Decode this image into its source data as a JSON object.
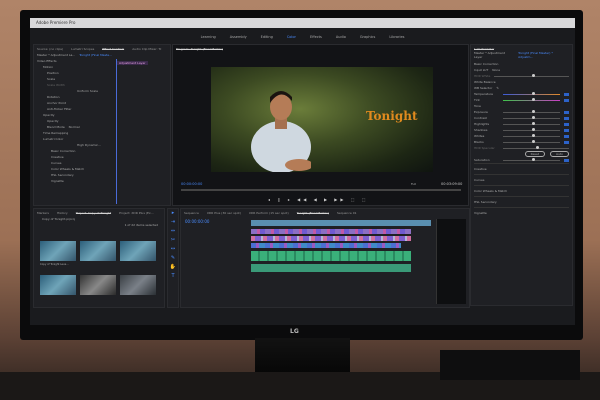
{
  "title_bar": "Adobe Premiere Pro",
  "workspaces": [
    "Learning",
    "Assembly",
    "Editing",
    "Color",
    "Effects",
    "Audio",
    "Graphics",
    "Libraries"
  ],
  "active_workspace": "Color",
  "left_panel": {
    "tabs": [
      "Source: (no clips)",
      "Lumetri Scopes",
      "Effect Controls",
      "Audio Clip Mixer: Tc"
    ],
    "clip": "Master * Adjustment La...",
    "sequence": "Tonight (Final Maste...",
    "tooltip": "Adjustment Layer",
    "section": "Video Effects",
    "items": [
      "Motion",
      "Position",
      "Scale",
      "Scale Width",
      "Uniform Scale",
      "Rotation",
      "Anchor Point",
      "Anti-flicker Filter",
      "Opacity",
      "Opacity",
      "Blend Mode",
      "Time Remapping",
      "Lumetri Color",
      "High Dynamic...",
      "Basic Correction",
      "Creative",
      "Curves",
      "Color Wheels & Match",
      "HSL Secondary",
      "Vignette"
    ],
    "blend_mode": "Normal"
  },
  "program": {
    "tab": "Program: Tonight (Final Master)",
    "overlay_text": "Tonight",
    "timecode_left": "00:00:00:00",
    "fit": "Full",
    "timecode_right": "00:03:09:00"
  },
  "lumetri": {
    "title": "Lumetri Color",
    "clip": "Master * Adjustment Layer",
    "sequence": "Tonight (Final Master) * Adjustm...",
    "basic": "Basic Correction",
    "input_lut_label": "Input LUT",
    "input_lut": "None",
    "hdr_white": "HDR White",
    "white_balance": "White Balance",
    "wb_selector": "WB Selector",
    "tone": "Tone",
    "sliders": [
      "Temperature",
      "Tint",
      "Exposure",
      "Contrast",
      "Highlights",
      "Shadows",
      "Whites",
      "Blacks",
      "HDR Specular"
    ],
    "reset": "Reset",
    "auto": "Auto",
    "saturation": "Saturation",
    "sections": [
      "Creative",
      "Curves",
      "Color Wheels & Match",
      "HSL Secondary",
      "Vignette"
    ]
  },
  "project": {
    "tabs": [
      "Markers",
      "History",
      "Project: Copy of Tonight",
      "Project: XDR Plus (Ex..."
    ],
    "bin": "Copy of Tonight.prproj",
    "selected": "1 of 22 items selected",
    "clip_label": "Copy of Tonight Leve..."
  },
  "timeline": {
    "tabs": [
      "Sequence",
      "XDR Plus (30 sec spot)",
      "XDR Perform (15 sec spot)",
      "Tonight (Final Master)",
      "Sequence 01"
    ],
    "timecode": "00:00:00:00"
  },
  "brand": "LG"
}
